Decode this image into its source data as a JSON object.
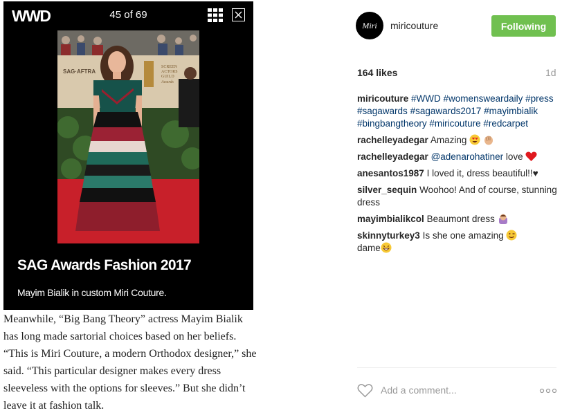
{
  "slide": {
    "brand": "WWD",
    "counter": "45 of 69",
    "title": "SAG Awards Fashion 2017",
    "caption": "Mayim Bialik in custom Miri Couture.",
    "backdrop_text": "SAG·AFTRA",
    "backdrop_logo": "SCREEN ACTORS GUILD Awards"
  },
  "article_text": "Meanwhile, “Big Bang Theory” actress Mayim Bialik has long made sartorial choices based on her beliefs. “This is Miri Couture, a modern Orthodox designer,” she said. “This particular designer makes every dress sleeveless with the options for sleeves.” But she didn’t leave it at fashion talk.",
  "post": {
    "avatar_text": "Miri",
    "username": "miricouture",
    "follow_label": "Following",
    "likes": "164 likes",
    "time_ago": "1d",
    "caption_user": "miricouture",
    "hashtags": [
      "#WWD",
      "#womenswe­ardaily",
      "#press",
      "#sagawards",
      "#sagawards2017",
      "#mayimbialik",
      "#bingbangtheory",
      "#miricouture",
      "#redcarpet"
    ],
    "comments": [
      {
        "user": "rachelleyadegar",
        "pre": "",
        "mention": "",
        "text": "Amazing",
        "emoji": "heart-eyes-clap"
      },
      {
        "user": "rachelleyadegar",
        "pre": "",
        "mention": "@adenarohatiner",
        "text": " love",
        "emoji": "red-heart"
      },
      {
        "user": "anesantos1987",
        "pre": "",
        "mention": "",
        "text": "I loved it, dress beautiful!!♥",
        "emoji": ""
      },
      {
        "user": "silver_sequin",
        "pre": "",
        "mention": "",
        "text": "Woohoo! And of course, stunning dress",
        "emoji": ""
      },
      {
        "user": "mayimbialikcol",
        "pre": "",
        "mention": "",
        "text": "Beaumont dress",
        "emoji": "person-bowing"
      },
      {
        "user": "skinnyturkey3",
        "pre": "",
        "mention": "",
        "text": "Is she one amazing",
        "emoji": "wink-grin"
      }
    ],
    "comment_tail": "dame",
    "add_comment_placeholder": "Add a comment...",
    "colors": {
      "follow": "#70c050",
      "link": "#003569",
      "heart": "#e0191e"
    }
  },
  "icons": {
    "grid": "grid-icon",
    "close": "close-icon",
    "like": "heart-outline-icon",
    "more": "more-options-icon"
  }
}
